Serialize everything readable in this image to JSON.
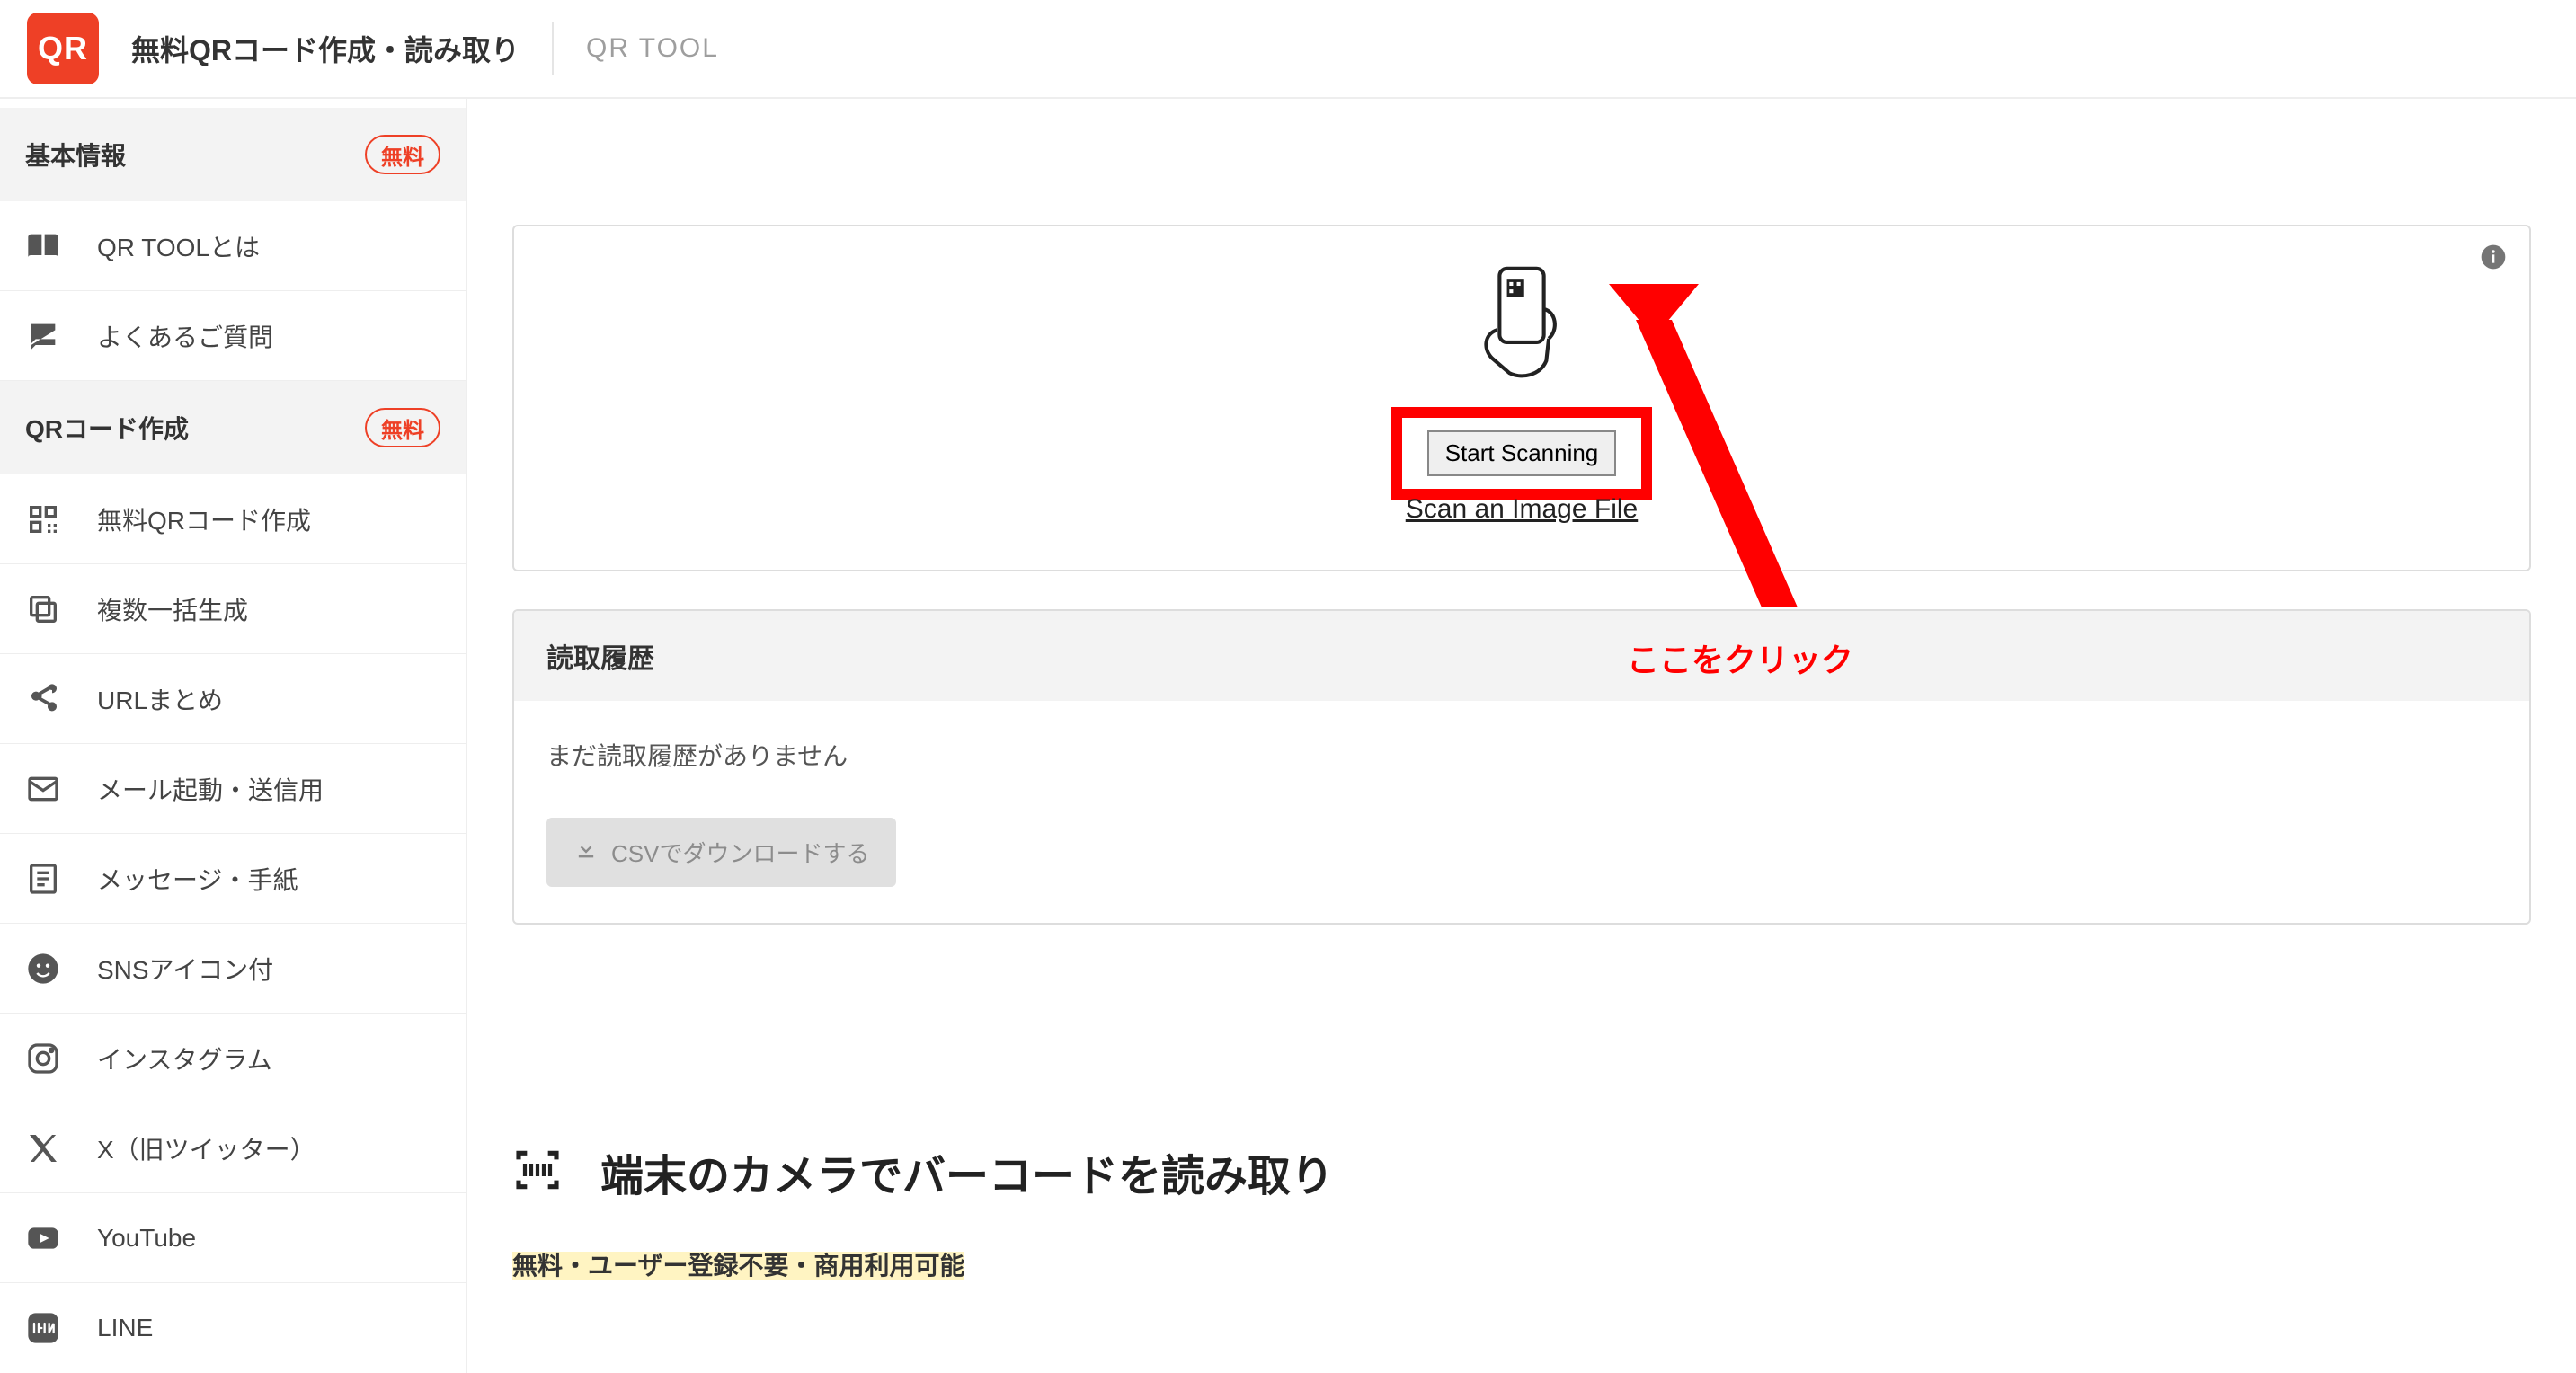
{
  "header": {
    "logo_text": "QR",
    "site_title": "無料QRコード作成・読み取り",
    "page_title": "QR TOOL"
  },
  "badges": {
    "free": "無料"
  },
  "sidebar": {
    "sections": [
      {
        "title": "基本情報",
        "items": [
          {
            "id": "about",
            "label": "QR TOOLとは",
            "icon": "book"
          },
          {
            "id": "faq",
            "label": "よくあるご質問",
            "icon": "chat"
          }
        ]
      },
      {
        "title": "QRコード作成",
        "items": [
          {
            "id": "create",
            "label": "無料QRコード作成",
            "icon": "qr"
          },
          {
            "id": "bulk",
            "label": "複数一括生成",
            "icon": "copy"
          },
          {
            "id": "url",
            "label": "URLまとめ",
            "icon": "share"
          },
          {
            "id": "mail",
            "label": "メール起動・送信用",
            "icon": "mail"
          },
          {
            "id": "message",
            "label": "メッセージ・手紙",
            "icon": "note"
          },
          {
            "id": "sns",
            "label": "SNSアイコン付",
            "icon": "smile"
          },
          {
            "id": "instagram",
            "label": "インスタグラム",
            "icon": "instagram"
          },
          {
            "id": "x",
            "label": "X（旧ツイッター）",
            "icon": "x"
          },
          {
            "id": "youtube",
            "label": "YouTube",
            "icon": "youtube"
          },
          {
            "id": "line",
            "label": "LINE",
            "icon": "line"
          }
        ]
      }
    ]
  },
  "scanner": {
    "start_label": "Start Scanning",
    "file_link": "Scan an Image File"
  },
  "annotation": {
    "text": "ここをクリック"
  },
  "history": {
    "header": "読取履歴",
    "empty": "まだ読取履歴がありません",
    "csv_label": "CSVでダウンロードする"
  },
  "section": {
    "heading": "端末のカメラでバーコードを読み取り",
    "highlight": "無料・ユーザー登録不要・商用利用可能"
  },
  "colors": {
    "accent": "#ee4026",
    "annotation": "#ff0000"
  }
}
